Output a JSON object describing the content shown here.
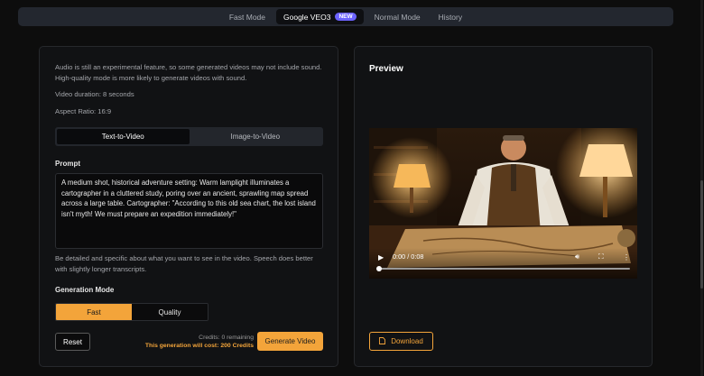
{
  "nav": {
    "tabs": [
      {
        "label": "Fast Mode"
      },
      {
        "label": "Google VEO3",
        "badge": "NEW"
      },
      {
        "label": "Normal Mode"
      },
      {
        "label": "History"
      }
    ],
    "active_tab": "Google VEO3"
  },
  "form": {
    "audio_note": "Audio is still an experimental feature, so some generated videos may not include sound. High-quality mode is more likely to generate videos with sound.",
    "duration": "Video duration: 8 seconds",
    "aspect": "Aspect Ratio: 16:9",
    "mode_tabs": [
      "Text-to-Video",
      "Image-to-Video"
    ],
    "active_mode": "Text-to-Video",
    "prompt_label": "Prompt",
    "prompt_value": "A medium shot, historical adventure setting: Warm lamplight illuminates a cartographer in a cluttered study, poring over an ancient, sprawling map spread across a large table. Cartographer: \"According to this old sea chart, the lost island isn't myth! We must prepare an expedition immediately!\"",
    "prompt_hint": "Be detailed and specific about what you want to see in the video. Speech does better with slightly longer transcripts.",
    "generation_mode_label": "Generation Mode",
    "generation_modes": [
      "Fast",
      "Quality"
    ],
    "active_generation_mode": "Fast",
    "reset_label": "Reset",
    "credits_remaining": "Credits: 0 remaining",
    "cost_note": "This generation will cost: 200 Credits",
    "generate_label": "Generate Video"
  },
  "preview": {
    "title": "Preview",
    "time": "0:00 / 0:08",
    "progress": 0,
    "download_label": "Download"
  },
  "colors": {
    "accent": "#f3a43a",
    "badge": "#6c63ff",
    "panel": "#111214"
  }
}
